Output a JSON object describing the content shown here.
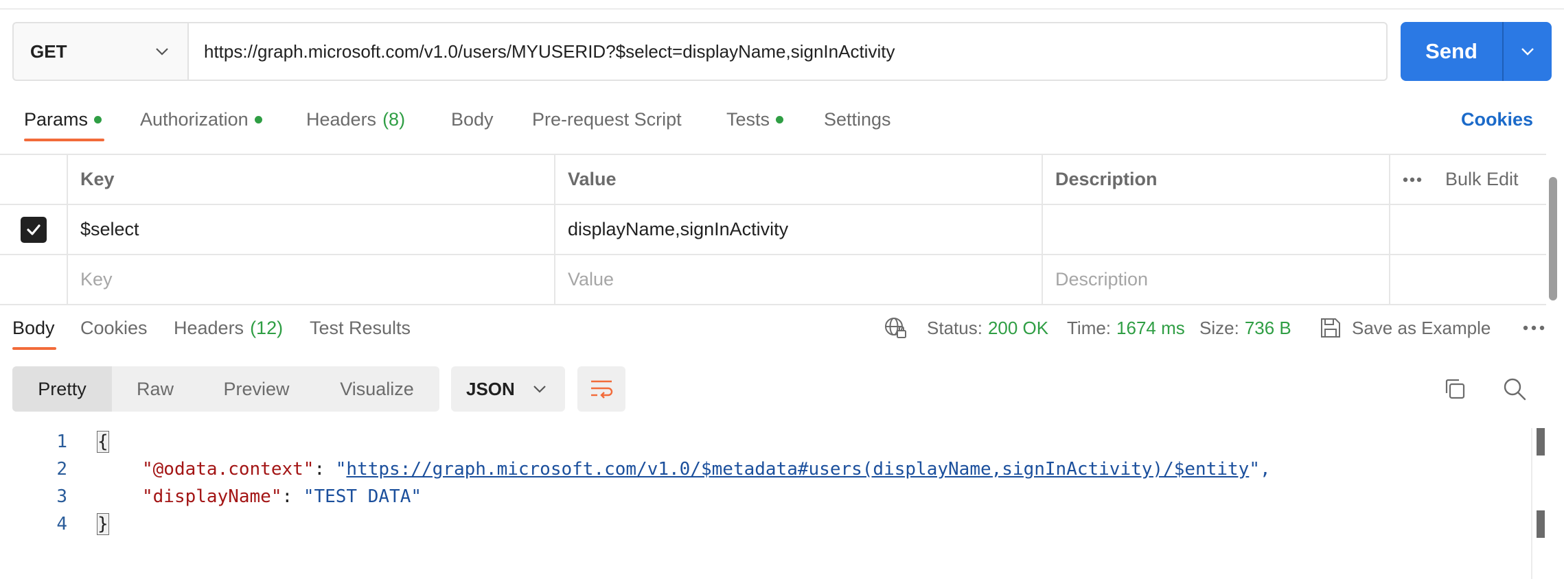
{
  "request": {
    "method": "GET",
    "url": "https://graph.microsoft.com/v1.0/users/MYUSERID?$select=displayName,signInActivity",
    "send_label": "Send"
  },
  "request_tabs": {
    "params": "Params",
    "authorization": "Authorization",
    "headers": "Headers",
    "headers_count": "(8)",
    "body": "Body",
    "prerequest": "Pre-request Script",
    "tests": "Tests",
    "settings": "Settings",
    "cookies": "Cookies"
  },
  "params_table": {
    "headers": {
      "key": "Key",
      "value": "Value",
      "description": "Description",
      "bulk_edit": "Bulk Edit"
    },
    "rows": [
      {
        "checked": true,
        "key": "$select",
        "value": "displayName,signInActivity",
        "description": ""
      }
    ],
    "placeholders": {
      "key": "Key",
      "value": "Value",
      "description": "Description"
    }
  },
  "response_tabs": {
    "body": "Body",
    "cookies": "Cookies",
    "headers": "Headers",
    "headers_count": "(12)",
    "test_results": "Test Results"
  },
  "response_meta": {
    "status_label": "Status:",
    "status_value": "200 OK",
    "time_label": "Time:",
    "time_value": "1674 ms",
    "size_label": "Size:",
    "size_value": "736 B",
    "save_example": "Save as Example"
  },
  "view_modes": [
    "Pretty",
    "Raw",
    "Preview",
    "Visualize"
  ],
  "active_view": "Pretty",
  "format": "JSON",
  "code": {
    "line_numbers": [
      "1",
      "2",
      "3",
      "4"
    ],
    "open_brace": "{",
    "close_brace": "}",
    "entries": [
      {
        "key": "\"@odata.context\"",
        "sep": ": ",
        "open_quote": "\"",
        "value": "https://graph.microsoft.com/v1.0/$metadata#users(displayName,signInActivity)/$entity",
        "close": "\","
      },
      {
        "key": "\"displayName\"",
        "sep": ": ",
        "value": "\"TEST DATA\""
      }
    ]
  },
  "colors": {
    "accent_orange": "#f26b3a",
    "send_blue": "#2b79e4",
    "success_green": "#2f9e44",
    "link_blue": "#1b6ac9",
    "json_key": "#a31515",
    "json_string": "#1b4f9c"
  },
  "icons": [
    "chevron-down-icon",
    "checkmark-icon",
    "more-horizontal-icon",
    "globe-lock-icon",
    "save-icon",
    "wrap-lines-icon",
    "copy-icon",
    "search-icon"
  ]
}
